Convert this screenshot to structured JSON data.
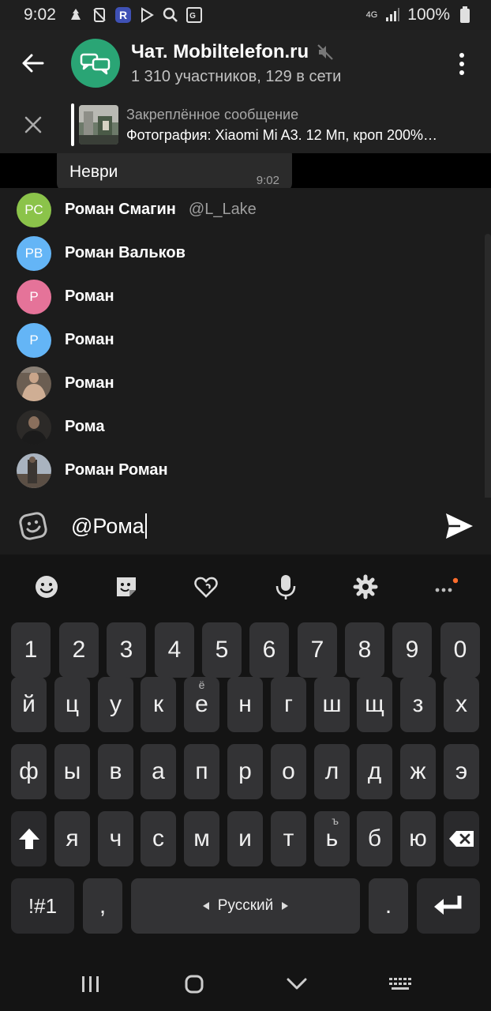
{
  "status_bar": {
    "time": "9:02",
    "network": "4G",
    "battery": "100%"
  },
  "header": {
    "title": "Чат. Mobiltelefon.ru",
    "subtitle": "1 310 участников, 129 в сети"
  },
  "pinned": {
    "label": "Закреплённое сообщение",
    "message": "Фотография: Xiaomi Mi A3.  12 Мп, кроп 200%…"
  },
  "chat": {
    "bubble_text": "Неври",
    "bubble_time": "9:02"
  },
  "mentions": [
    {
      "initials": "РС",
      "name": "Роман Смагин",
      "username": "@L_Lake",
      "color": "#8bc34a"
    },
    {
      "initials": "РВ",
      "name": "Роман Вальков",
      "username": "",
      "color": "#64b5f6"
    },
    {
      "initials": "Р",
      "name": "Роман",
      "username": "",
      "color": "#e57399"
    },
    {
      "initials": "Р",
      "name": "Роман",
      "username": "",
      "color": "#64b5f6"
    },
    {
      "initials": "",
      "name": "Роман",
      "username": "",
      "color": "#7a6a5c"
    },
    {
      "initials": "",
      "name": "Рома",
      "username": "",
      "color": "#3a3530"
    },
    {
      "initials": "",
      "name": "Роман Роман",
      "username": "",
      "color": "#4a4f58"
    }
  ],
  "input": {
    "value": "@Рома"
  },
  "keyboard": {
    "numbers": [
      "1",
      "2",
      "3",
      "4",
      "5",
      "6",
      "7",
      "8",
      "9",
      "0"
    ],
    "row1": [
      "й",
      "ц",
      "у",
      "к",
      "е",
      "н",
      "г",
      "ш",
      "щ",
      "з",
      "х"
    ],
    "row1_hint_e": "ё",
    "row2": [
      "ф",
      "ы",
      "в",
      "а",
      "п",
      "р",
      "о",
      "л",
      "д",
      "ж",
      "э"
    ],
    "row3": [
      "я",
      "ч",
      "с",
      "м",
      "и",
      "т",
      "ь",
      "б",
      "ю"
    ],
    "row3_hint_soft": "ъ",
    "symbols_label": "!#1",
    "comma": ",",
    "space_label": "Русский",
    "period": "."
  },
  "colors": {
    "accent": "#2aa575",
    "keyboard_notif": "#ff6d2d"
  }
}
